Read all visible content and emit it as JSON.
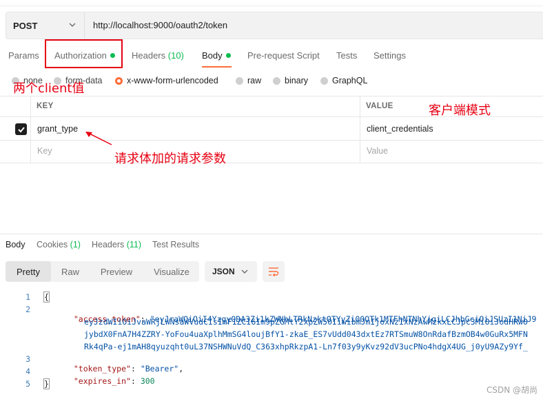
{
  "request": {
    "method": "POST",
    "url": "http://localhost:9000/oauth2/token"
  },
  "tabs": [
    {
      "label": "Params"
    },
    {
      "label": "Authorization"
    },
    {
      "label": "Headers",
      "count": "(10)"
    },
    {
      "label": "Body"
    },
    {
      "label": "Pre-request Script"
    },
    {
      "label": "Tests"
    },
    {
      "label": "Settings"
    }
  ],
  "body_types": [
    {
      "label": "none"
    },
    {
      "label": "form-data"
    },
    {
      "label": "x-www-form-urlencoded"
    },
    {
      "label": "raw"
    },
    {
      "label": "binary"
    },
    {
      "label": "GraphQL"
    }
  ],
  "params_table": {
    "headers": {
      "key": "KEY",
      "value": "VALUE"
    },
    "rows": [
      {
        "key": "grant_type",
        "value": "client_credentials"
      }
    ],
    "placeholder": {
      "key": "Key",
      "value": "Value"
    }
  },
  "annotations": {
    "client_values": "两个client值",
    "client_mode": "客户端模式",
    "body_params": "请求体加的请求参数"
  },
  "response": {
    "tabs": [
      {
        "label": "Body"
      },
      {
        "label": "Cookies",
        "count": "(1)"
      },
      {
        "label": "Headers",
        "count": "(11)"
      },
      {
        "label": "Test Results"
      }
    ],
    "views": [
      {
        "label": "Pretty"
      },
      {
        "label": "Raw"
      },
      {
        "label": "Preview"
      },
      {
        "label": "Visualize"
      }
    ],
    "format": "JSON",
    "code": {
      "line_numbers": [
        "1",
        "2",
        "3",
        "4",
        "5"
      ],
      "open": "{",
      "close": "}",
      "access_token_key": "\"access_token\"",
      "access_token_lines": [
        "\"eyJraWQiOiI4YzgyODA3Zi1kZWNhLTRkNzktOTYyZi00OTk1MTFhNTNhYjgiLCJhbGciOiJSUzI1NiJ9",
        "eyJzdWIiOiJvaWRjLWNsaWVudCIsImF1ZCI6Im9pZGMtY2xpZW50IiwibmJmIjoxNzIxNzAwMzkxLCJpc3MiOiJodHRwO",
        "jybdX0FnA7H4ZZRY-YoFou4uaXplhMmSG4loujBfY1-zkaE_ES7vUdd043dxtEz7RTSmuW8OnRdafBzmOB4w0GuRx5MFN",
        "Rk4qPa-ej1mAH8qyuzqht0uL37NSHWNuVdQ_C363xhpRkzpA1-Ln7f03y9yKvz92dV3ucPNo4hdgX4UG_j0yU9AZy9Yf_"
      ],
      "token_type_key": "\"token_type\"",
      "token_type_value": "\"Bearer\"",
      "expires_in_key": "\"expires_in\"",
      "expires_in_value": "300"
    }
  },
  "watermark": "CSDN @胡尚"
}
